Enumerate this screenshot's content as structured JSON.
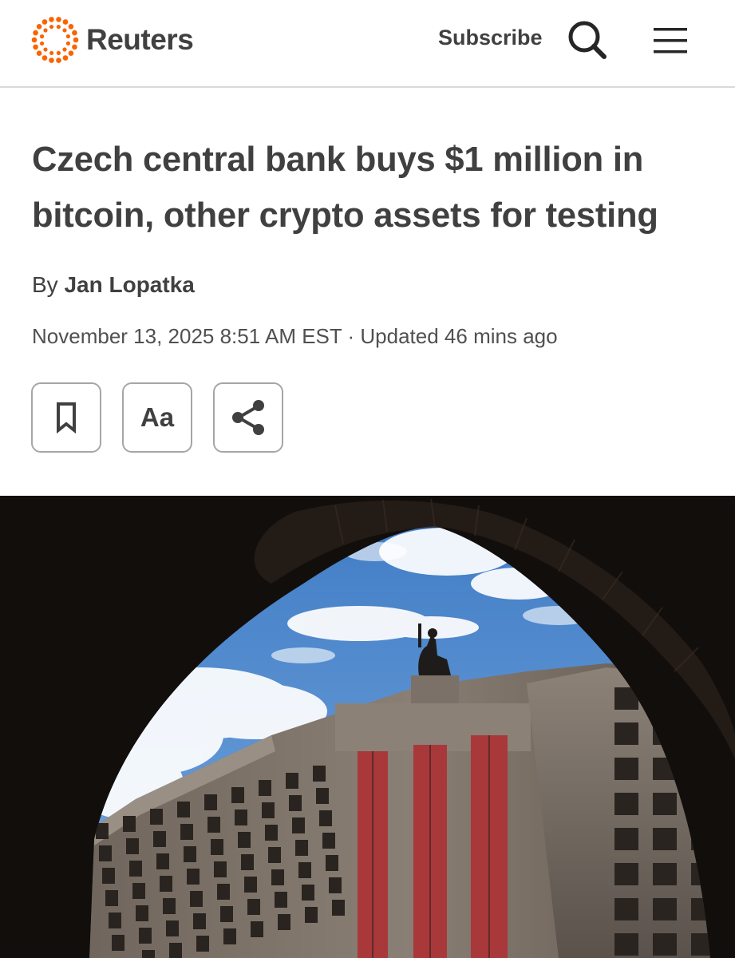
{
  "header": {
    "logo_text": "Reuters",
    "subscribe_label": "Subscribe",
    "search_icon": "search-icon",
    "menu_icon": "hamburger-menu-icon",
    "brand_color": "#fa6400"
  },
  "article": {
    "headline": "Czech central bank buys $1 million in bitcoin, other crypto assets for testing",
    "byline_prefix": "By",
    "author": "Jan Lopatka",
    "dateline": "November 13, 2025 8:51 AM EST · Updated 46 mins ago"
  },
  "actions": {
    "bookmark_icon": "bookmark-icon",
    "text_size_label": "Aa",
    "share_icon": "share-icon"
  },
  "photo": {
    "subject": "Czech National Bank building seen through a dark archway under blue sky with clouds"
  }
}
